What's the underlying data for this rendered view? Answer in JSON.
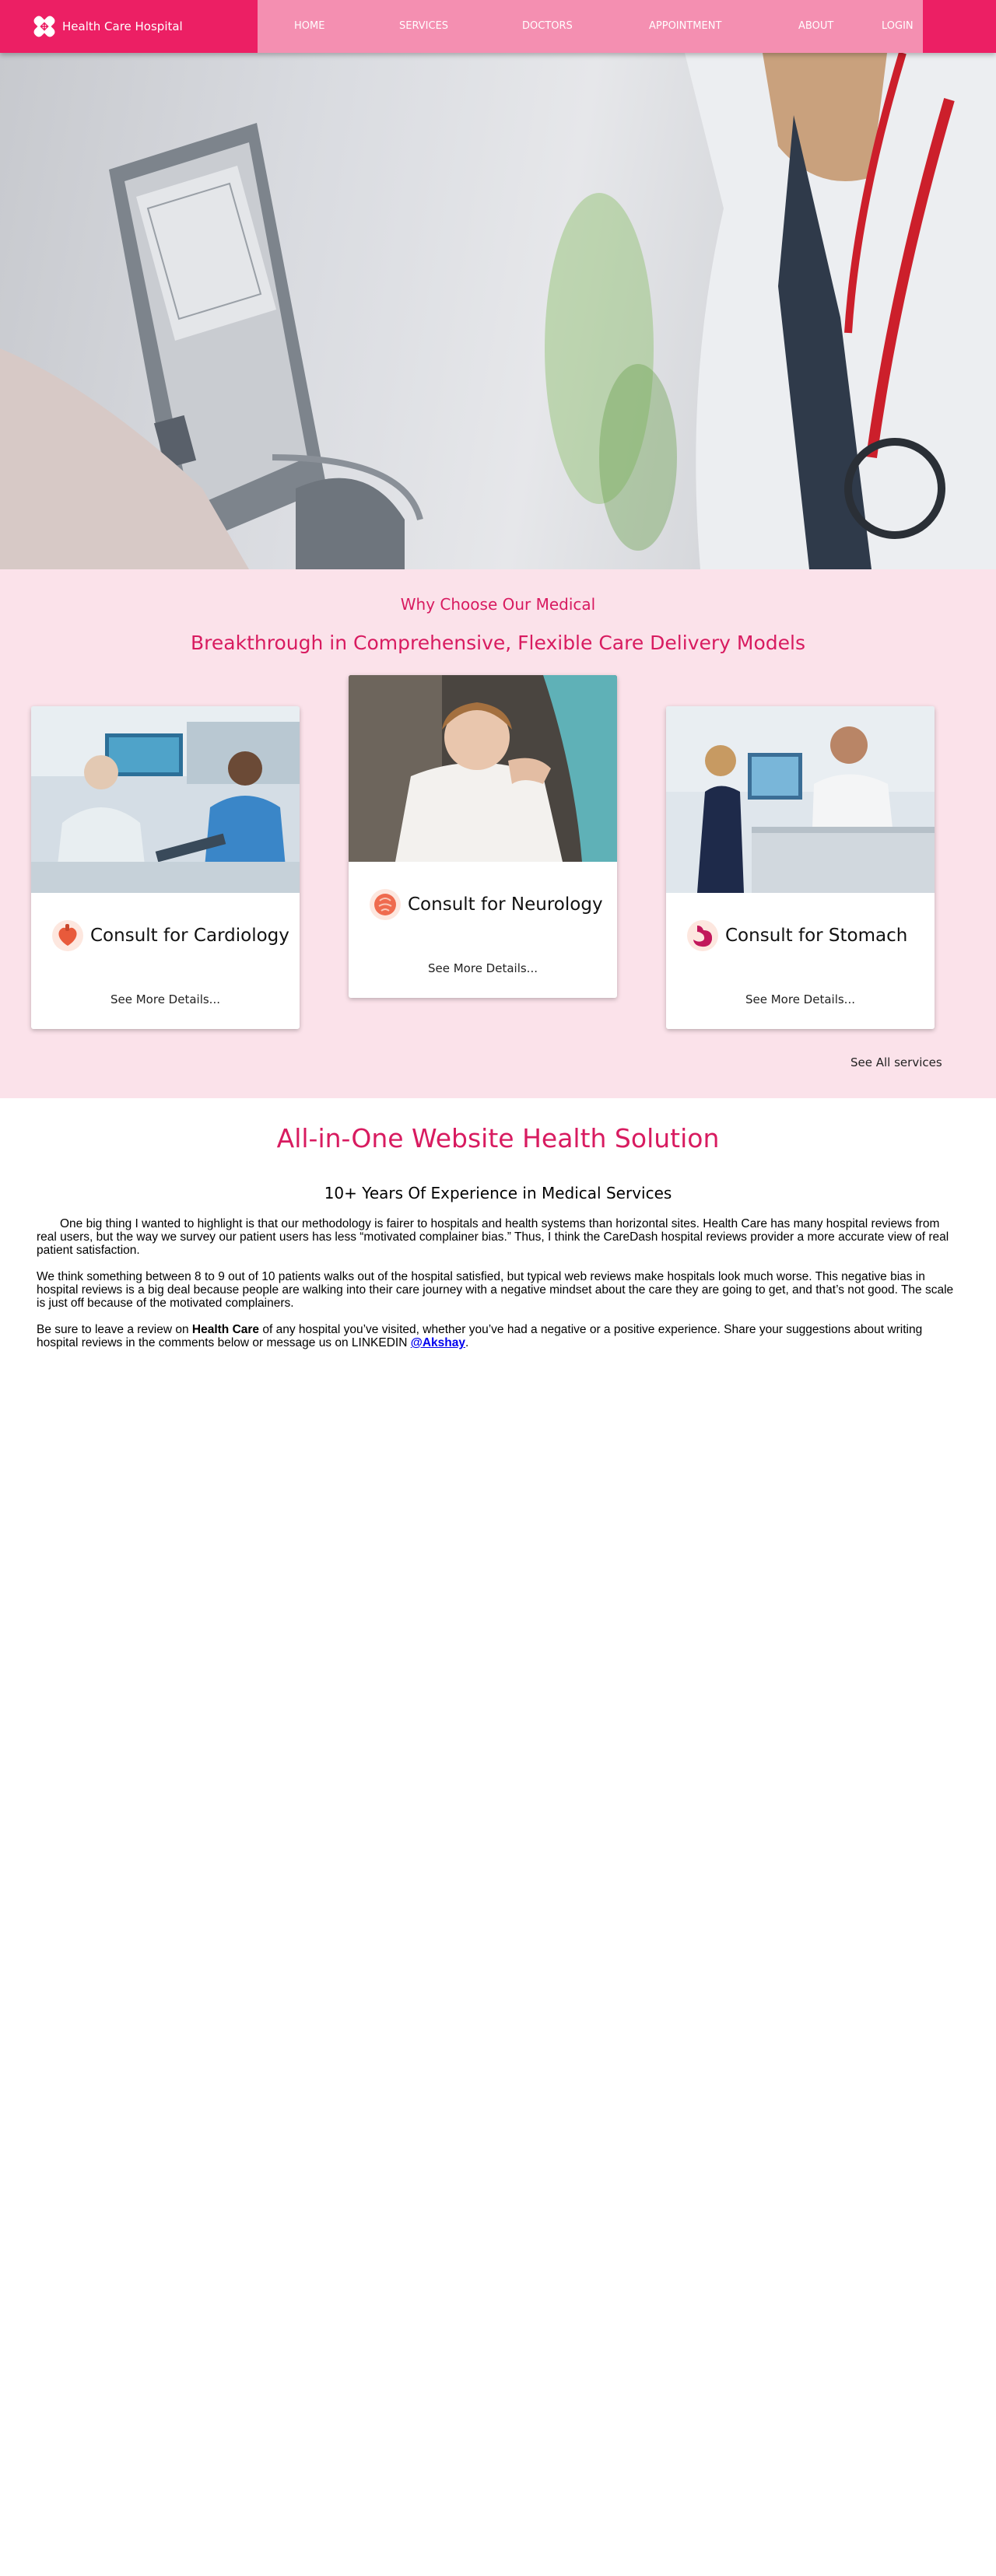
{
  "nav": {
    "brand": "Health Care Hospital",
    "links": [
      "HOME",
      "SERVICES",
      "DOCTORS",
      "APPOINTMENT",
      "ABOUT"
    ],
    "login": "LOGIN"
  },
  "hero": {
    "description": "Banner photo: doctor measuring patient blood pressure"
  },
  "why": {
    "subtitle": "Why Choose Our Medical",
    "title": "Breakthrough in Comprehensive, Flexible Care Delivery Models",
    "cards": [
      {
        "title": "Consult for Cardiology",
        "link": "See More Details...",
        "icon": "heart-icon"
      },
      {
        "title": "Consult for Neurology",
        "link": "See More Details...",
        "icon": "brain-icon"
      },
      {
        "title": "Consult for Stomach",
        "link": "See More Details...",
        "icon": "stomach-icon"
      }
    ],
    "see_all": "See All services"
  },
  "aio": {
    "title": "All-in-One Website Health Solution",
    "subtitle": "10+ Years Of Experience in Medical Services",
    "p1": "One big thing I wanted to highlight is that our methodology is fairer to hospitals and health systems than horizontal sites. Health Care has many hospital reviews from real users, but the way we survey our patient users has less “motivated complainer bias.” Thus, I think the CareDash hospital reviews provider a more accurate view of real patient satisfaction.",
    "p2": "We think something between 8 to 9 out of 10 patients walks out of the hospital satisfied, but typical web reviews make hospitals look much worse. This negative bias in hospital reviews is a big deal because people are walking into their care journey with a negative mindset about the care they are going to get, and that’s not good. The scale is just off because of the motivated complainers.",
    "p3_prefix": "Be sure to leave a review on ",
    "p3_bold": "Health Care",
    "p3_middle": " of any hospital you’ve visited, whether you’ve had a negative or a positive experience. Share your suggestions about writing hospital reviews in the comments below or message us on LINKEDIN ",
    "p3_link": "@Akshay",
    "p3_end": "."
  },
  "colors": {
    "brand": "#ec1f64",
    "nav": "#f48fb1",
    "accent_text": "#d81b60",
    "section_bg": "#fbe2ea"
  }
}
